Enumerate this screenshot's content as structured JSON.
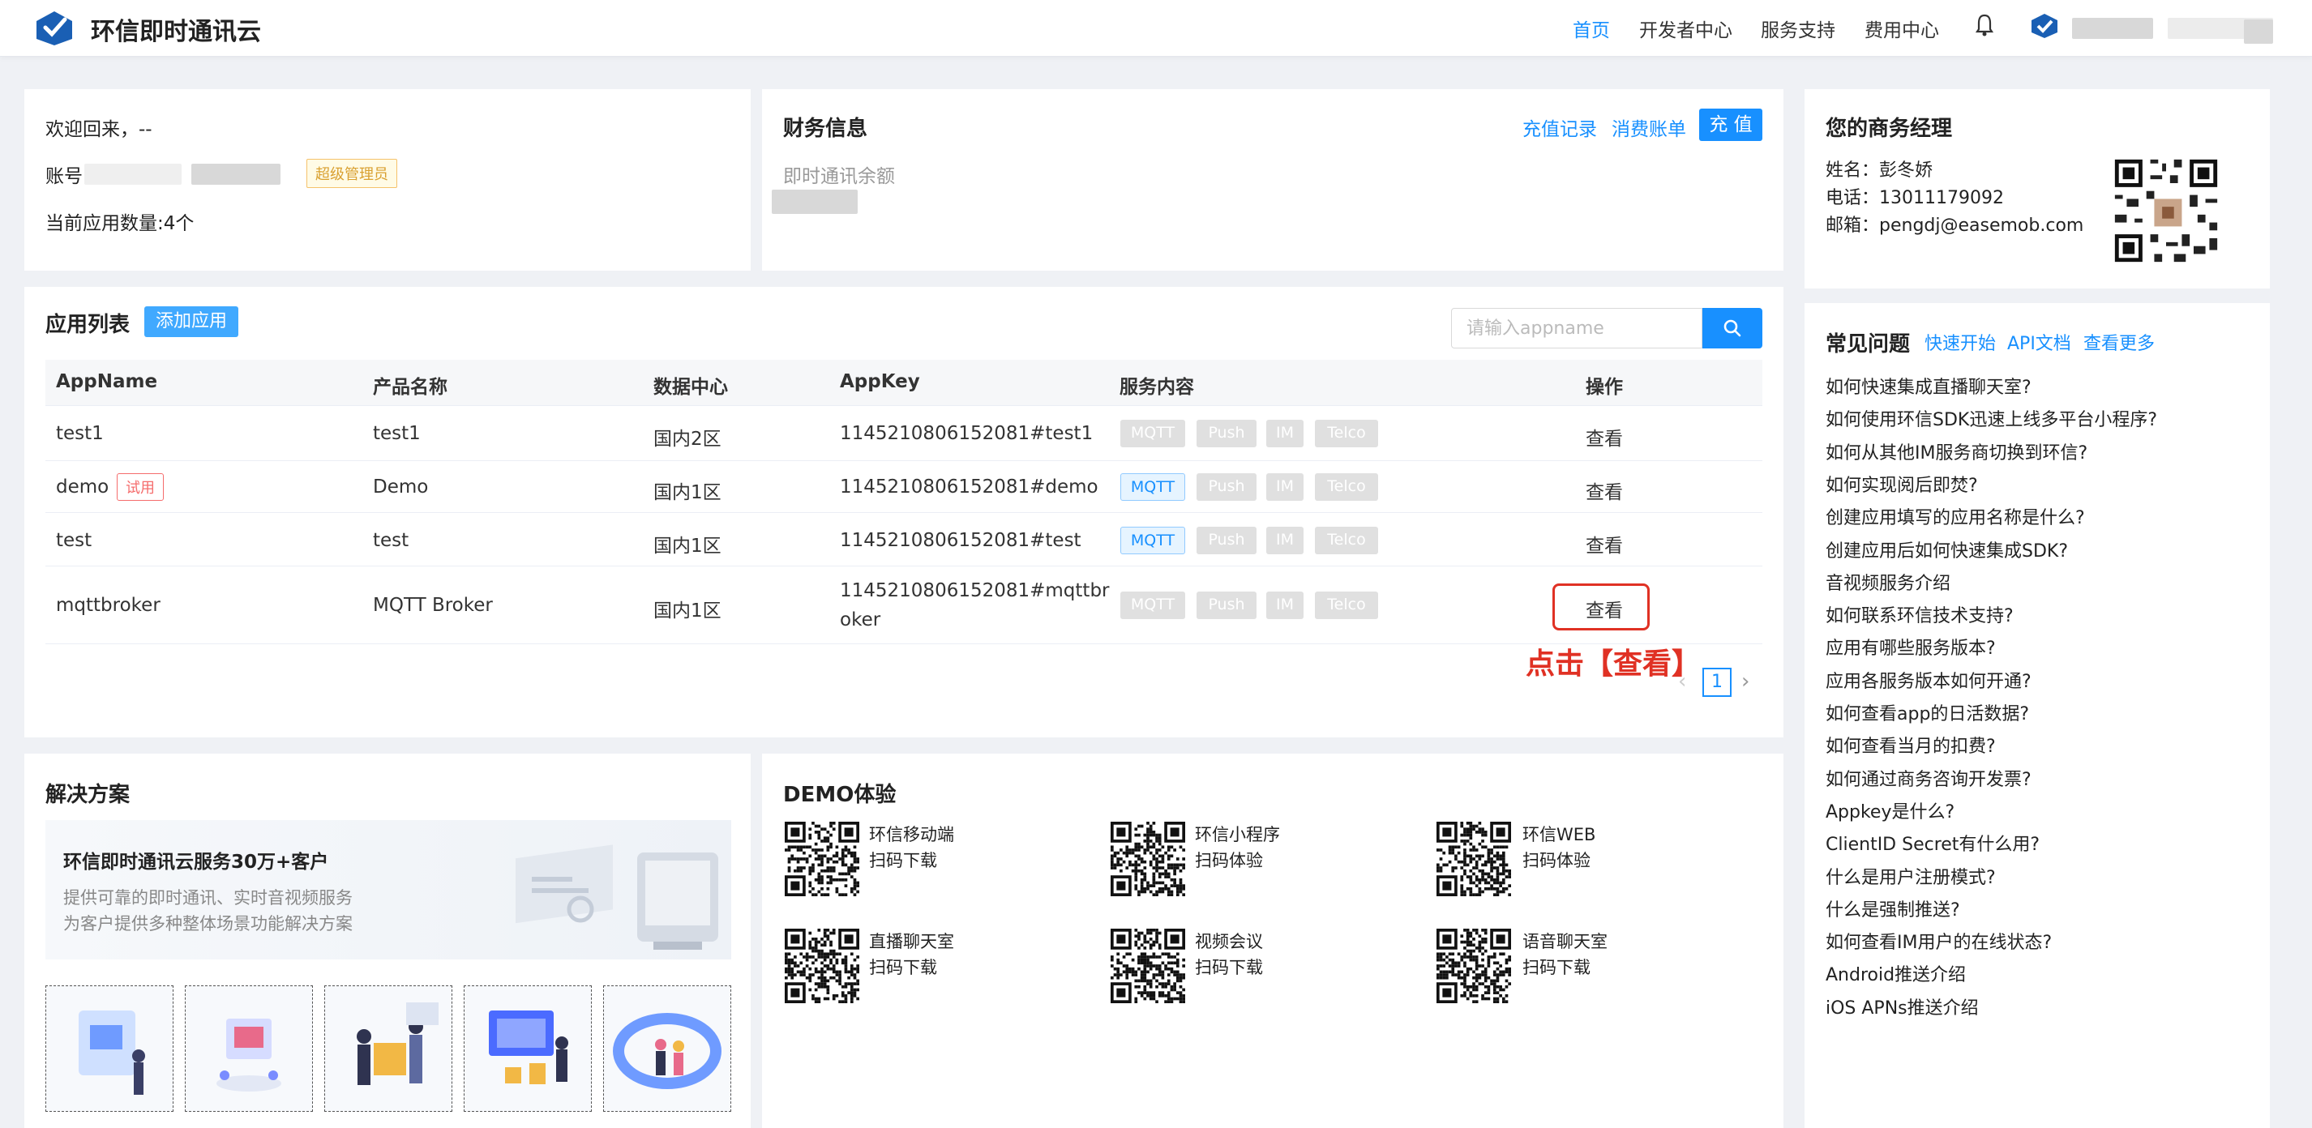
{
  "header": {
    "brand": "环信即时通讯云",
    "nav": [
      "首页",
      "开发者中心",
      "服务支持",
      "费用中心"
    ]
  },
  "welcome": {
    "greeting": "欢迎回来，--",
    "account_label": "账号",
    "role_tag": "超级管理员",
    "app_count": "当前应用数量:4个"
  },
  "finance": {
    "title": "财务信息",
    "recharge_record": "充值记录",
    "bills": "消费账单",
    "recharge_button": "充 值",
    "balance_label": "即时通讯余额"
  },
  "manager": {
    "title": "您的商务经理",
    "name": "姓名：彭冬娇",
    "phone": "电话：13011179092",
    "email": "邮箱：pengdj@easemob.com"
  },
  "app_list": {
    "title": "应用列表",
    "add_button": "添加应用",
    "search_placeholder": "请输入appname",
    "columns": [
      "AppName",
      "产品名称",
      "数据中心",
      "AppKey",
      "服务内容",
      "操作"
    ],
    "services": [
      "MQTT",
      "Push",
      "IM",
      "Telco"
    ],
    "rows": [
      {
        "name": "test1",
        "product": "test1",
        "dc": "国内2区",
        "key": "1145210806152081#test1",
        "action": "查看"
      },
      {
        "name": "demo",
        "trial": "试用",
        "product": "Demo",
        "dc": "国内1区",
        "key": "1145210806152081#demo",
        "action": "查看"
      },
      {
        "name": "test",
        "product": "test",
        "dc": "国内1区",
        "key": "1145210806152081#test",
        "action": "查看"
      },
      {
        "name": "mqttbroker",
        "product": "MQTT Broker",
        "dc": "国内1区",
        "key_line1": "1145210806152081#mqttbr",
        "key_line2": "oker",
        "action": "查看"
      }
    ],
    "annotation": "点击【查看】",
    "page": "1"
  },
  "solutions": {
    "title": "解决方案",
    "promo_title": "环信即时通讯云服务30万+客户",
    "promo_line1": "提供可靠的即时通讯、实时音视频服务",
    "promo_line2": "为客户提供多种整体场景功能解决方案"
  },
  "demo": {
    "title": "DEMO体验",
    "items": [
      {
        "name": "环信移动端",
        "action": "扫码下载"
      },
      {
        "name": "环信小程序",
        "action": "扫码体验"
      },
      {
        "name": "环信WEB",
        "action": "扫码体验"
      },
      {
        "name": "直播聊天室",
        "action": "扫码下载"
      },
      {
        "name": "视频会议",
        "action": "扫码下载"
      },
      {
        "name": "语音聊天室",
        "action": "扫码下载"
      }
    ]
  },
  "faq": {
    "title": "常见问题",
    "links": [
      "快速开始",
      "API文档",
      "查看更多"
    ],
    "questions": [
      "如何快速集成直播聊天室?",
      "如何使用环信SDK迅速上线多平台小程序?",
      "如何从其他IM服务商切换到环信?",
      "如何实现阅后即焚?",
      "创建应用填写的应用名称是什么?",
      "创建应用后如何快速集成SDK?",
      "音视频服务介绍",
      "如何联系环信技术支持?",
      "应用有哪些服务版本?",
      "应用各服务版本如何开通?",
      "如何查看app的日活数据?",
      "如何查看当月的扣费?",
      "如何通过商务咨询开发票?",
      "Appkey是什么?",
      "ClientID Secret有什么用?",
      "什么是用户注册模式?",
      "什么是强制推送?",
      "如何查看IM用户的在线状态?",
      "Android推送介绍",
      "iOS APNs推送介绍"
    ]
  }
}
